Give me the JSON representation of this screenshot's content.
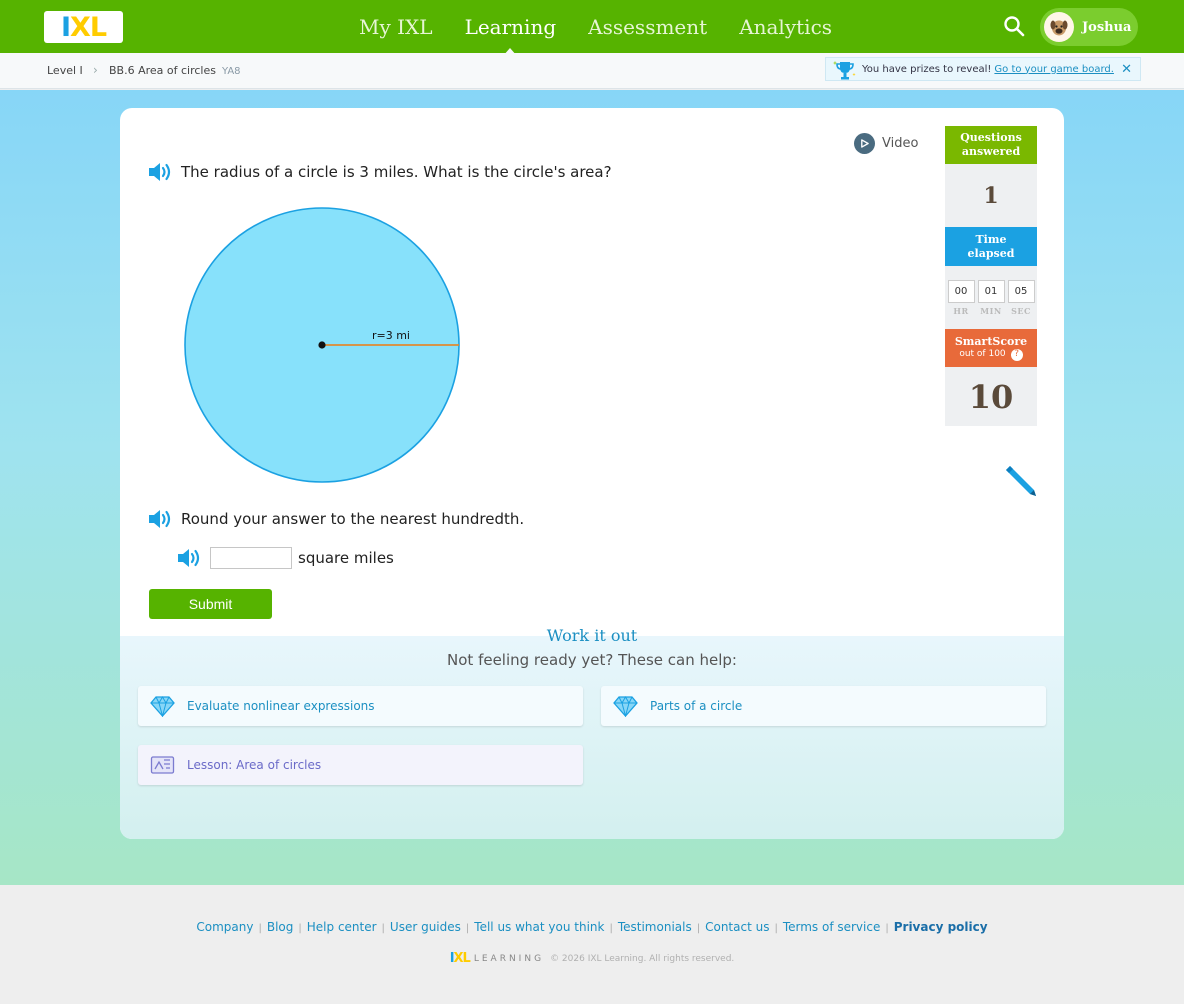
{
  "brand": {
    "logo_text": "IXL",
    "user_name": "Joshua"
  },
  "nav": {
    "items": [
      "My IXL",
      "Learning",
      "Assessment",
      "Analytics"
    ],
    "active_index": 1
  },
  "breadcrumb": {
    "level": "Level I",
    "skill": "BB.6 Area of circles",
    "code": "YA8"
  },
  "prize_banner": {
    "text": "You have prizes to reveal!",
    "link": "Go to your game board."
  },
  "question": {
    "prompt": "The radius of a circle is 3 miles. What is the circle's area?",
    "video_label": "Video",
    "diagram_label": "r=3 mi",
    "round_instruction": "Round your answer to the nearest hundredth.",
    "answer_value": "",
    "unit": "square miles",
    "submit_label": "Submit"
  },
  "stats": {
    "questions_answered_label_1": "Questions",
    "questions_answered_label_2": "answered",
    "questions_answered": "1",
    "time_label_1": "Time",
    "time_label_2": "elapsed",
    "hr": "00",
    "min": "01",
    "sec": "05",
    "hr_label": "HR",
    "min_label": "MIN",
    "sec_label": "SEC",
    "smartscore_label": "SmartScore",
    "smartscore_sub": "out of 100",
    "smartscore": "10"
  },
  "help": {
    "title": "Work it out",
    "subtitle": "Not feeling ready yet? These can help:",
    "items": [
      "Evaluate nonlinear expressions",
      "Parts of a circle",
      "Lesson: Area of circles"
    ]
  },
  "footer": {
    "links": [
      "Company",
      "Blog",
      "Help center",
      "User guides",
      "Tell us what you think",
      "Testimonials",
      "Contact us",
      "Terms of service",
      "Privacy policy"
    ],
    "learning": "LEARNING",
    "copyright": "© 2026 IXL Learning. All rights reserved."
  },
  "colors": {
    "green": "#56b300",
    "blue": "#1b8fc2",
    "orange": "#e86a3a",
    "circle_fill": "#87e1fb"
  }
}
